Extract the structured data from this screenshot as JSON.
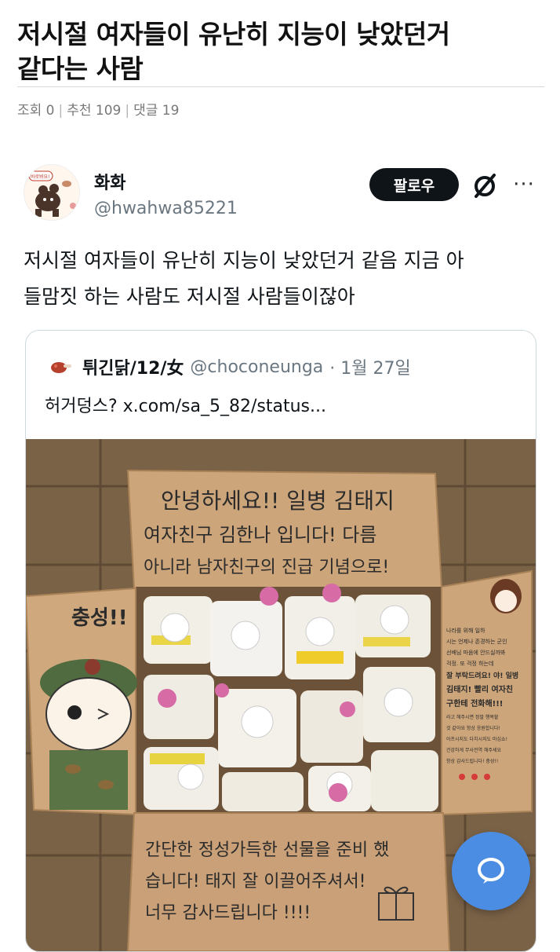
{
  "post": {
    "title_line1": "저시절 여자들이 유난히 지능이 낮았던거",
    "title_line2": "같다는 사람",
    "views_label": "조회 0",
    "recommend_label": "추천 109",
    "comments_label": "댓글 19",
    "separator": "|"
  },
  "tweet": {
    "author_name": "화화",
    "author_handle": "@hwahwa85221",
    "follow_label": "팔로우",
    "more_label": "···",
    "text_line1": "저시절 여자들이 유난히 지능이 낮았던거 같음 지금 아",
    "text_line2": "들맘짓 하는 사람도 저시절 사람들이잖아",
    "avatar_text": "바로봐요!"
  },
  "quote": {
    "author_name": "튀긴닭/12/女",
    "author_handle": "@choconeunga",
    "date": "· 1월 27일",
    "text": "허거덩스? x.com/sa_5_82/status..."
  },
  "photo": {
    "top_note": [
      "안녕하세요!! 일병 김태지",
      "여자친구 김한나 입니다! 다름",
      "아니라 남자친구의 진급 기념으로!"
    ],
    "bottom_note": [
      "간단한 정성가득한 선물을 준비 했",
      "습니다! 태지 잘 이끌어주셔서!",
      "너무 감사드립니다 !!!!"
    ],
    "left_flap_text": "충성!!",
    "right_flap_lines": [
      "나라를 위해 일하",
      "시는 언제나 존경하는 군인",
      "선배님 마음에 안드실까봐",
      "걱정. 또 걱정 하는데",
      "잘 부탁드려요! 야! 일병",
      "김태지! 빨리 여자친",
      "구한테 전화해!!!",
      "라고 해주시면 정말 행복할",
      "것 같아요 항상 응원합니다!",
      "아프시지도 다치시지도 마십쇼!",
      "건강하게 무사전역 해주세요",
      "항상 감사드립니다! 충성!!"
    ]
  },
  "fab": {
    "icon": "chat-bubble-icon"
  },
  "colors": {
    "follow_bg": "#0f1419",
    "fab_bg": "#4b8de3",
    "handle_gray": "#6b7780",
    "meta_gray": "#777777"
  }
}
